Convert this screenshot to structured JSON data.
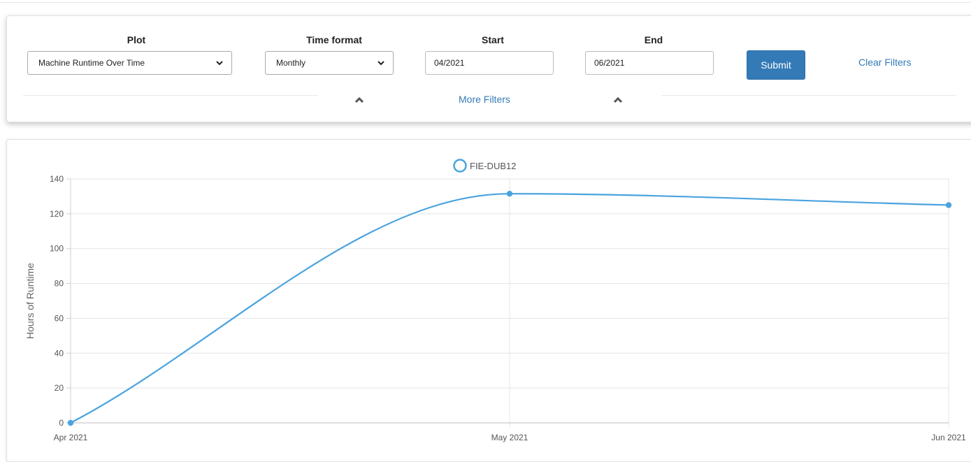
{
  "filters": {
    "plot": {
      "label": "Plot",
      "value": "Machine Runtime Over Time"
    },
    "time_format": {
      "label": "Time format",
      "value": "Monthly"
    },
    "start": {
      "label": "Start",
      "value": "04/2021"
    },
    "end": {
      "label": "End",
      "value": "06/2021"
    },
    "submit_label": "Submit",
    "clear_label": "Clear Filters",
    "more_filters_label": "More Filters"
  },
  "colors": {
    "accent": "#337ab7",
    "series": "#4aa3df"
  },
  "icons": {
    "select_caret": "chevron-down-icon",
    "more_filters_caret": "chevron-up-icon"
  },
  "chart_data": {
    "type": "line",
    "x": [
      "Apr 2021",
      "May 2021",
      "Jun 2021"
    ],
    "series": [
      {
        "name": "FIE-DUB12",
        "values": [
          0,
          131.5,
          125
        ]
      }
    ],
    "ylabel": "Hours of Runtime",
    "ylim": [
      0,
      140
    ],
    "yticks": [
      0,
      20,
      40,
      60,
      80,
      100,
      120,
      140
    ],
    "grid": true,
    "legend": "top-center"
  }
}
